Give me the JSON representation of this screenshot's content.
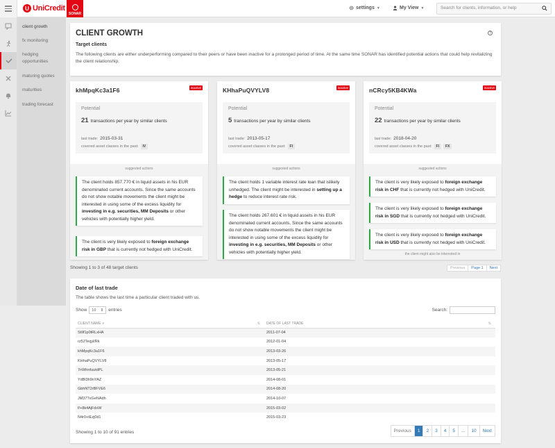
{
  "brand": {
    "name": "UniCredit",
    "app": "SONAR",
    "accent": "#e30613"
  },
  "topbar": {
    "settings_label": "settings",
    "my_view_label": "My View",
    "search_placeholder": "Search for clients, information, or help"
  },
  "sidebar": {
    "items": [
      {
        "label": "client growth",
        "icon": "chat-icon"
      },
      {
        "label": "fx monitoring",
        "icon": "run-icon"
      },
      {
        "label": "hedging opportunities",
        "icon": "handshake-icon"
      },
      {
        "label": "maturing quotes",
        "icon": "tools-icon"
      },
      {
        "label": "maturities",
        "icon": "bell-icon"
      },
      {
        "label": "trading forecast",
        "icon": "chart-icon"
      }
    ]
  },
  "hero": {
    "title": "CLIENT GROWTH",
    "subtitle": "Target clients",
    "description": "The following clients are either underperforming compared to their peers or have been inactive for a prolonged period of time. At the same time SONAR has identified potential actions that could help revitalizing the client relationship.",
    "help": "?"
  },
  "cards": [
    {
      "name": "khMpqKc3a1F6",
      "status": "inactive",
      "potential_label": "Potential",
      "transactions": "21",
      "transactions_text": "transactions per year by similar clients",
      "last_trade_label": "last trade:",
      "last_trade": "2015-03-31",
      "asset_label": "covered asset classes in the past:",
      "assets": [
        "IV"
      ],
      "suggested_label": "suggested actions",
      "actions": [
        {
          "pre": "The client holds 857.770 € in liquid assets in his EUR denominated current accounts. Since the same accounts do not show notable movements the client might be interested in using some of the excess liquidity for ",
          "bold": "investing in e.g. securities, MM Deposits",
          "post": " or other vehicles with potentially higher yield."
        },
        {
          "pre": "The client is very likely exposed to ",
          "bold": "foreign exchange risk in GBP",
          "post": " that is currently not hedged with UniCredit."
        }
      ]
    },
    {
      "name": "KHhaPuQVYLV8",
      "status": "inactive",
      "potential_label": "Potential",
      "transactions": "5",
      "transactions_text": "transactions per year by similar clients",
      "last_trade_label": "last trade:",
      "last_trade": "2013-05-17",
      "asset_label": "covered asset classes in the past:",
      "assets": [
        "FI"
      ],
      "suggested_label": "suggested actions",
      "actions": [
        {
          "pre": "The client holds 1 variable interest rate loan that islikely unhedged. The client might be interested in ",
          "bold": "setting up a hedge",
          "post": " to reduce interest rate risk."
        },
        {
          "pre": "The client holds 267.601 € in liquid assets in his EUR denominated current accounts. Since the same accounts do not show notable movements the client might be interested in using some of the excess liquidity for ",
          "bold": "investing in e.g. securities, MM Deposits",
          "post": " or other vehicles with potentially higher yield."
        }
      ]
    },
    {
      "name": "nCRcy5KB4KWa",
      "status": "inactive",
      "potential_label": "Potential",
      "transactions": "22",
      "transactions_text": "transactions per year by similar clients",
      "last_trade_label": "last trade:",
      "last_trade": "2018-04-20",
      "asset_label": "covered asset classes in the past:",
      "assets": [
        "FI",
        "FX"
      ],
      "suggested_label": "suggested actions",
      "might_label": "the client might also be interested in",
      "actions": [
        {
          "pre": "The client is very likely exposed to ",
          "bold": "foreign exchange risk in CHF",
          "post": " that is currently not hedged with UniCredit."
        },
        {
          "pre": "The client is very likely exposed to ",
          "bold": "foreign exchange risk in SGD",
          "post": " that is currently not hedged with UniCredit."
        },
        {
          "pre": "The client is very likely exposed to ",
          "bold": "foreign exchange risk in USD",
          "post": " that is currently not hedged with UniCredit."
        }
      ]
    }
  ],
  "cards_pager": {
    "info": "Showing 1 to 3 of 48 target clients",
    "prev": "Previous",
    "page": "Page 1",
    "next": "Next"
  },
  "table_panel": {
    "title": "Date of last trade",
    "description": "The table shows the last time a particular client traded with us.",
    "show_label": "Show",
    "page_size": "10",
    "entries_label": "entries",
    "search_label": "Search:",
    "columns": [
      "CLIENT NAME",
      "DATE OF LAST TRADE"
    ],
    "rows": [
      [
        "StIlf1p0tRLxHA",
        "2011-07-04"
      ],
      [
        "rz5JTeqyl/Rk",
        "2012-01-04"
      ],
      [
        "khMpqKc3a1F6",
        "2013-03-26"
      ],
      [
        "KHhaPuQVYLV8",
        "2013-05-17"
      ],
      [
        "7nWhnfuutdPL",
        "2013-05-21"
      ],
      [
        "YdBl3h9nYAZ",
        "2014-08-01"
      ],
      [
        "GbhNT2rBFVE6",
        "2014-08-20"
      ],
      [
        "JM37TxGeNAdh",
        "2014-10-07"
      ],
      [
        "f/+8k4AjFdxW",
        "2015-03-02"
      ],
      [
        "N4r0+tEzj0d1",
        "2015-03-23"
      ]
    ],
    "info": "Showing 1 to 10 of 91 entries",
    "pagination": [
      "Previous",
      "1",
      "2",
      "3",
      "4",
      "5",
      "...",
      "10",
      "Next"
    ]
  }
}
